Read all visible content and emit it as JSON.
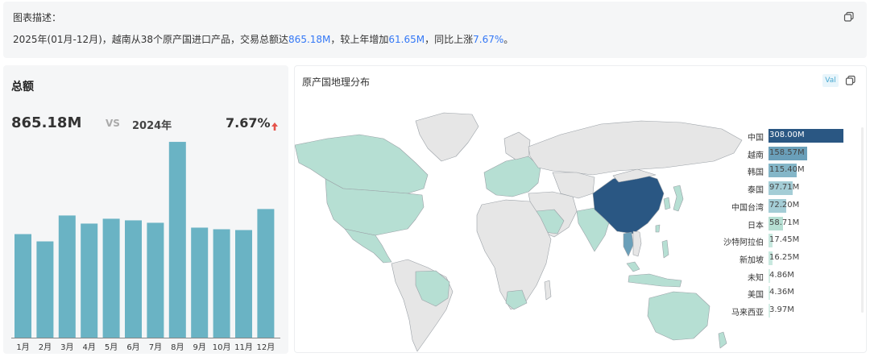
{
  "description": {
    "title": "图表描述：",
    "text_1": "2025年(01月-12月)，越南从38个原产国进口产品，交易总额达",
    "total": "865.18M",
    "text_2": "，较上年增加",
    "increase": "61.65M",
    "text_3": "，同比上涨",
    "growth": "7.67%",
    "text_4": "。"
  },
  "summary": {
    "title": "总额",
    "value": "865.18M",
    "vs": "VS",
    "compare_year": "2024年",
    "growth_pct": "7.67%",
    "trend": "up",
    "trend_color": "#e5534b"
  },
  "chart_data": {
    "type": "bar",
    "categories": [
      "1月",
      "2月",
      "3月",
      "4月",
      "5月",
      "6月",
      "7月",
      "8月",
      "9月",
      "10月",
      "11月",
      "12月"
    ],
    "values": [
      64,
      59.5,
      75.5,
      70.5,
      73.5,
      72.5,
      71,
      121,
      68,
      67,
      66.5,
      79.5
    ],
    "ylim": [
      0,
      128
    ],
    "bar_color": "#6ab3c4",
    "grid": false
  },
  "map_panel": {
    "title": "原产国地理分布",
    "val_button": "Val",
    "legend": [
      {
        "name": "中国",
        "value": 308.0,
        "label": "308.00M"
      },
      {
        "name": "越南",
        "value": 158.57,
        "label": "158.57M"
      },
      {
        "name": "韩国",
        "value": 115.4,
        "label": "115.40M"
      },
      {
        "name": "泰国",
        "value": 97.71,
        "label": "97.71M"
      },
      {
        "name": "中国台湾",
        "value": 72.2,
        "label": "72.20M"
      },
      {
        "name": "日本",
        "value": 58.71,
        "label": "58.71M"
      },
      {
        "name": "沙特阿拉伯",
        "value": 17.45,
        "label": "17.45M"
      },
      {
        "name": "新加坡",
        "value": 16.25,
        "label": "16.25M"
      },
      {
        "name": "未知",
        "value": 4.86,
        "label": "4.86M"
      },
      {
        "name": "美国",
        "value": 4.36,
        "label": "4.36M"
      },
      {
        "name": "马来西亚",
        "value": 3.97,
        "label": "3.97M"
      }
    ],
    "colors": {
      "dark": "#2a5783",
      "mid": "#6a9fb9",
      "light": "#b6dfd3",
      "empty": "#e6e6e6"
    }
  },
  "icons": {
    "copy": "copy-icon",
    "trend_up": "arrow-up-icon"
  }
}
